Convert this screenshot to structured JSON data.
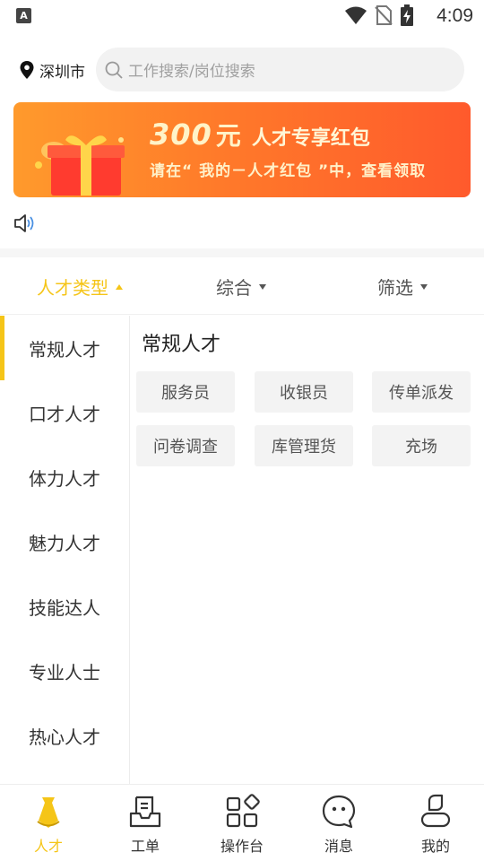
{
  "status_bar": {
    "time": "4:09",
    "app_icon_letter": "A"
  },
  "header": {
    "location": "深圳市",
    "search": {
      "placeholder": "工作搜索/岗位搜索"
    }
  },
  "banner": {
    "amount": "300",
    "unit": "元",
    "headline": "人才专享红包",
    "subtitle": "请在“ 我的－人才红包 ”中，查看领取"
  },
  "filters": [
    {
      "label": "人才类型",
      "active": true
    },
    {
      "label": "综合",
      "active": false
    },
    {
      "label": "筛选",
      "active": false
    }
  ],
  "categories": [
    "常规人才",
    "口才人才",
    "体力人才",
    "魅力人才",
    "技能达人",
    "专业人士",
    "热心人才"
  ],
  "content": {
    "title": "常规人才",
    "tags": [
      "服务员",
      "收银员",
      "传单派发",
      "问卷调查",
      "库管理货",
      "充场"
    ]
  },
  "bottom_nav": [
    {
      "label": "人才",
      "icon": "talent-icon",
      "active": true
    },
    {
      "label": "工单",
      "icon": "work-order-icon",
      "active": false
    },
    {
      "label": "操作台",
      "icon": "dashboard-icon",
      "active": false
    },
    {
      "label": "消息",
      "icon": "message-icon",
      "active": false
    },
    {
      "label": "我的",
      "icon": "profile-icon",
      "active": false
    }
  ],
  "colors": {
    "accent": "#f5c518",
    "banner_start": "#ff9a2c",
    "banner_end": "#ff5a2c"
  }
}
